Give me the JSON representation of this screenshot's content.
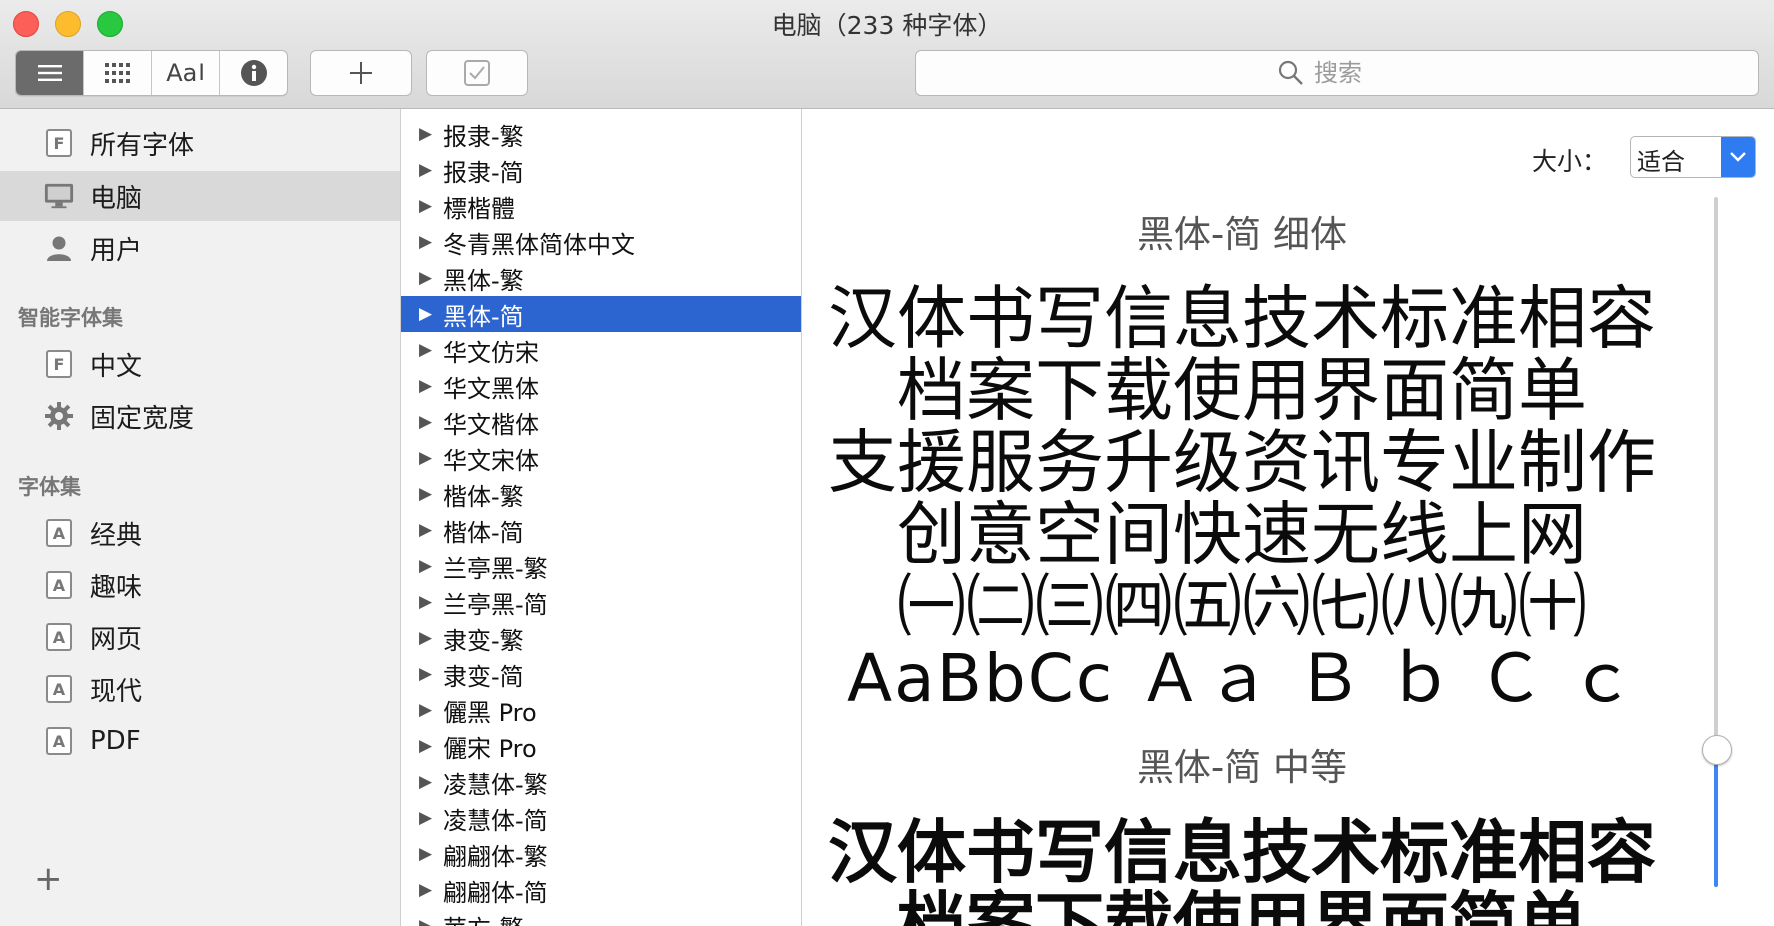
{
  "window": {
    "title": "电脑（233 种字体）"
  },
  "toolbar": {
    "view_buttons": [
      "list-view",
      "grid-view",
      "sample-view",
      "info-view"
    ],
    "sample_label": "Aa",
    "search": {
      "placeholder": "搜索"
    }
  },
  "sidebar": {
    "items": [
      {
        "label": "所有字体",
        "icon": "font-file-icon"
      },
      {
        "label": "电脑",
        "icon": "computer-icon"
      },
      {
        "label": "用户",
        "icon": "user-icon"
      }
    ],
    "smart_header": "智能字体集",
    "smart_items": [
      {
        "label": "中文",
        "icon": "font-file-icon"
      },
      {
        "label": "固定宽度",
        "icon": "gear-icon"
      }
    ],
    "collections_header": "字体集",
    "collections": [
      {
        "label": "经典"
      },
      {
        "label": "趣味"
      },
      {
        "label": "网页"
      },
      {
        "label": "现代"
      },
      {
        "label": "PDF"
      }
    ],
    "add_label": "+"
  },
  "font_list": {
    "items": [
      "报隶-繁",
      "报隶-简",
      "標楷體",
      "冬青黑体简体中文",
      "黑体-繁",
      "黑体-简",
      "华文仿宋",
      "华文黑体",
      "华文楷体",
      "华文宋体",
      "楷体-繁",
      "楷体-简",
      "兰亭黑-繁",
      "兰亭黑-简",
      "隶变-繁",
      "隶变-简",
      "儷黑 Pro",
      "儷宋 Pro",
      "凌慧体-繁",
      "凌慧体-简",
      "翩翩体-繁",
      "翩翩体-简",
      "苹方-繁"
    ],
    "selected_index": 5
  },
  "preview": {
    "size_label": "大小：",
    "size_value": "适合",
    "sections": [
      {
        "heading": "黑体-简 细体",
        "lines": [
          "汉体书写信息技术标准相容",
          "档案下载使用界面简单",
          "支援服务升级资讯专业制作",
          "创意空间快速无线上网",
          "㈠㈡㈢㈣㈤㈥㈦㈧㈨㈩",
          "AaBbCc Ａａ Ｂ ｂ Ｃ ｃ"
        ]
      },
      {
        "heading": "黑体-简 中等",
        "lines": [
          "汉体书写信息技术标准相容",
          "档案下载使用界面简单"
        ]
      }
    ],
    "size_slider_fraction": 0.2
  }
}
